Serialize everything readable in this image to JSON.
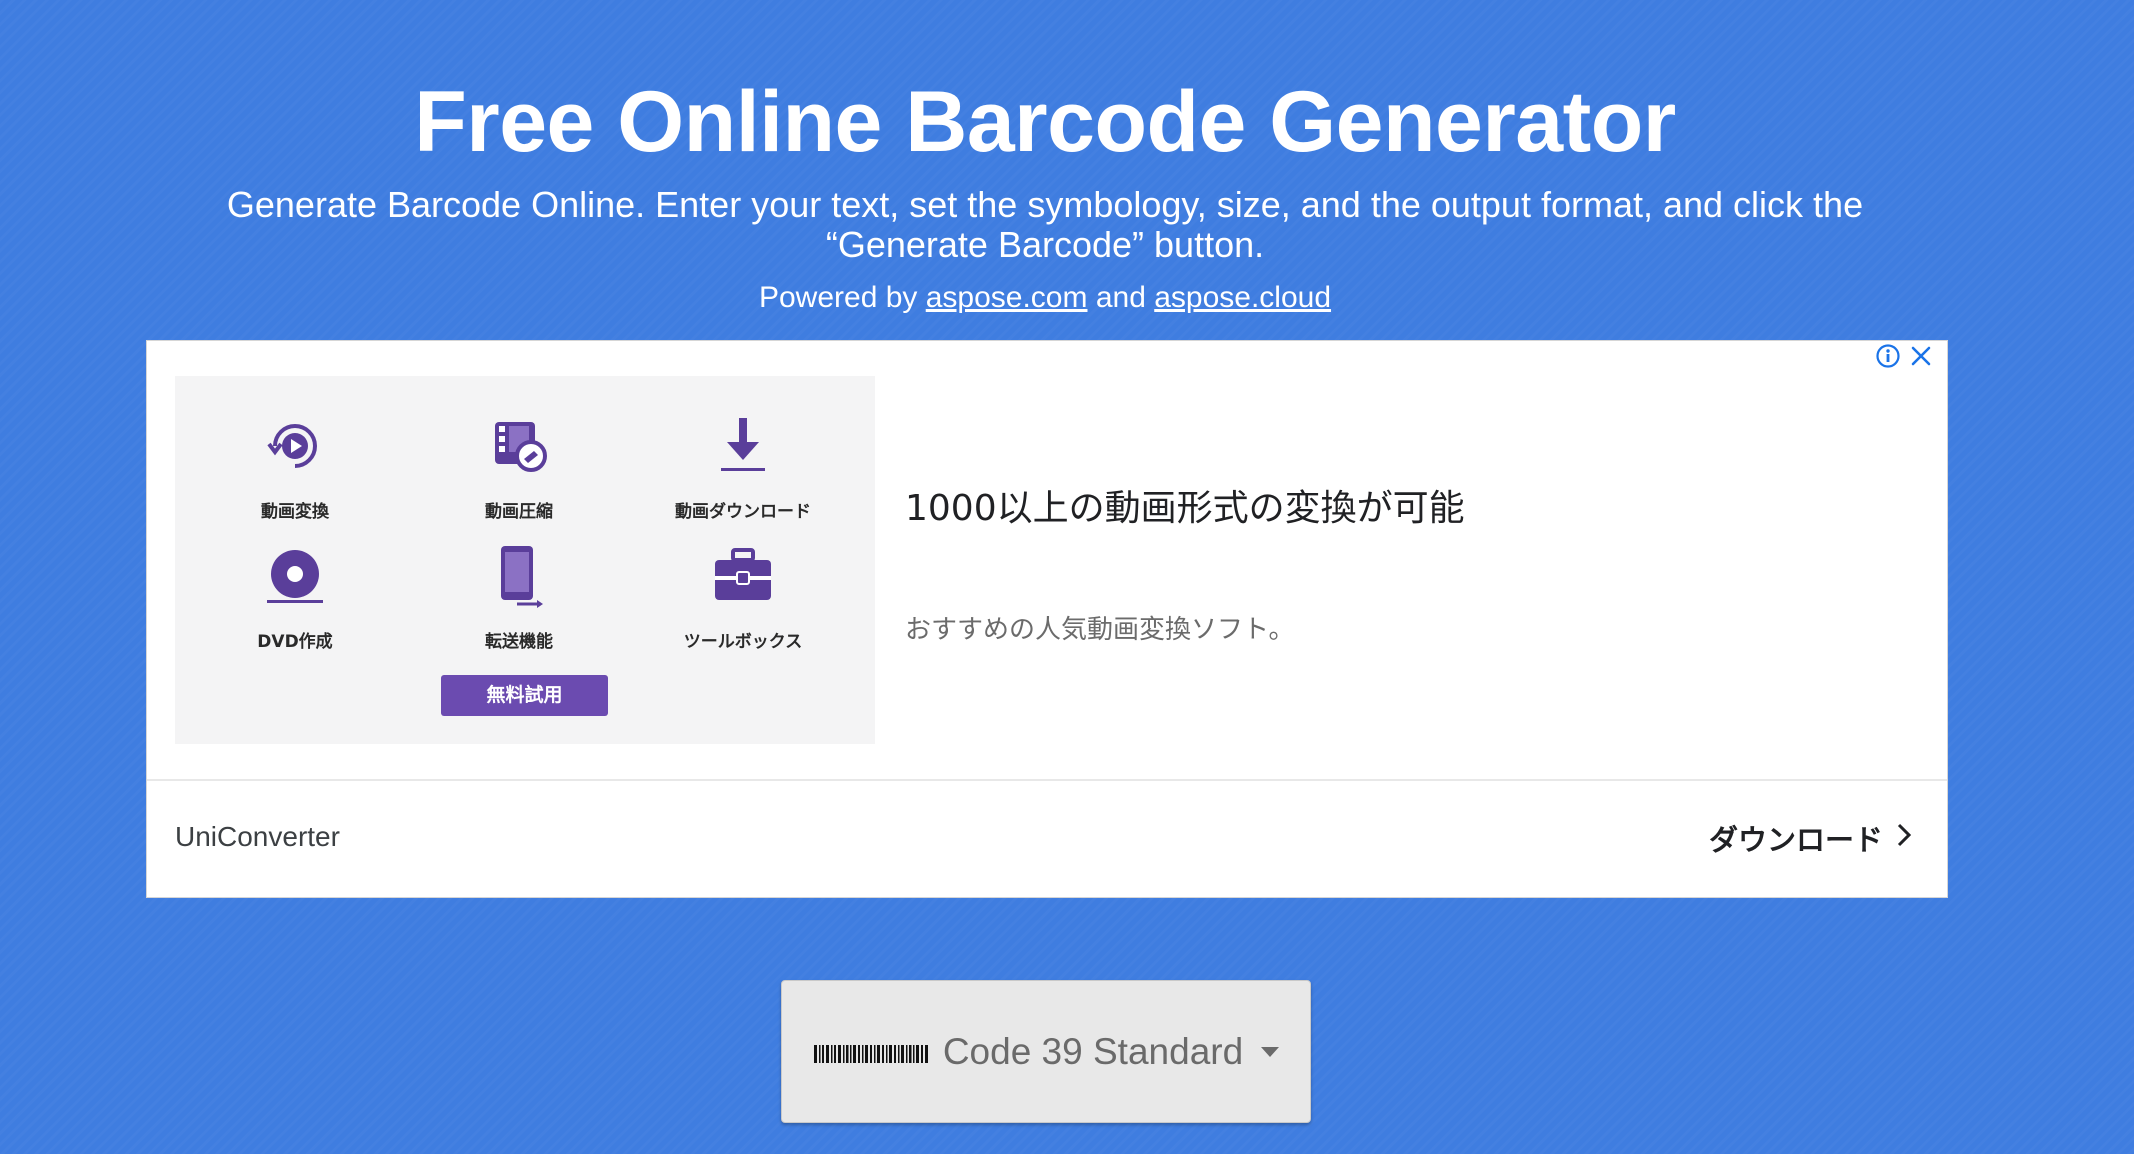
{
  "header": {
    "title": "Free Online Barcode Generator",
    "subtitle": "Generate Barcode Online. Enter your text, set the symbology, size, and the output format, and click the “Generate Barcode” button.",
    "powered_prefix": "Powered by ",
    "powered_link1": "aspose.com",
    "powered_and": " and ",
    "powered_link2": "aspose.cloud"
  },
  "ad": {
    "features": [
      {
        "label": "動画変換",
        "icon": "convert-play-icon"
      },
      {
        "label": "動画圧縮",
        "icon": "compress-film-icon"
      },
      {
        "label": "動画ダウンロード",
        "icon": "download-arrow-icon"
      },
      {
        "label": "DVD作成",
        "icon": "disc-icon"
      },
      {
        "label": "転送機能",
        "icon": "device-transfer-icon"
      },
      {
        "label": "ツールボックス",
        "icon": "toolbox-icon"
      }
    ],
    "trial_button": "無料試用",
    "headline": "1000以上の動画形式の変換が可能",
    "description": "おすすめの人気動画変換ソフト。",
    "brand": "UniConverter",
    "cta": "ダウンロード",
    "accent_color": "#6b4bb0",
    "info_color": "#1a73e8"
  },
  "symbology": {
    "selected": "Code 39 Standard",
    "icon": "barcode-icon"
  },
  "colors": {
    "background": "#3f7de0",
    "selector_bg": "#e8e8e8"
  }
}
